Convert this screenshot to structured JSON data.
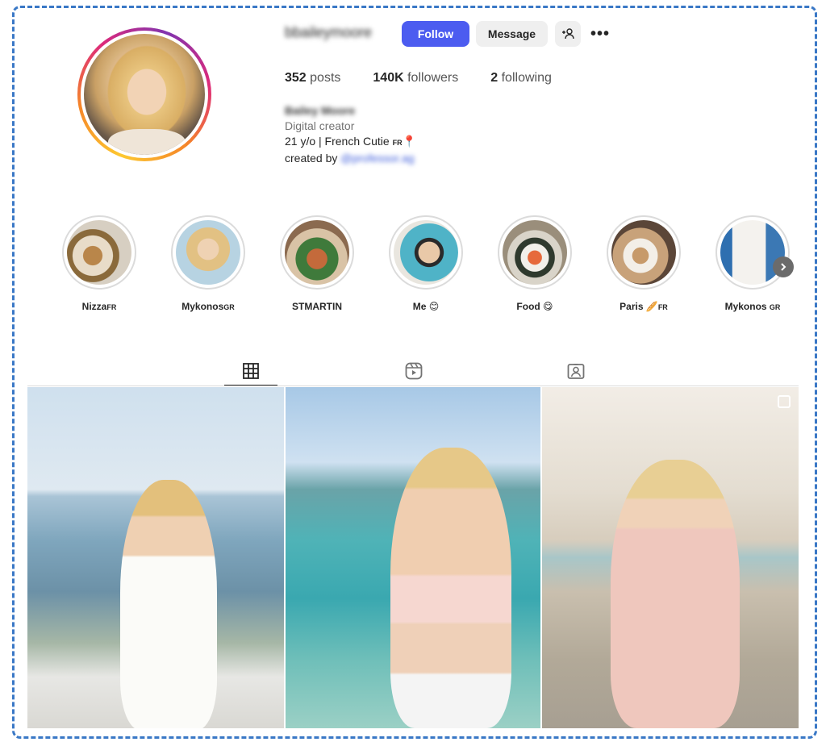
{
  "profile": {
    "username": "bbaileymoore",
    "full_name": "Bailey Moore",
    "category": "Digital creator",
    "bio_line1": "21 y/o | French Cutie ",
    "bio_line1_flag": "FR",
    "bio_line1_emoji": "📍",
    "created_by_prefix": "created by ",
    "created_by_link": "@professor.ag"
  },
  "actions": {
    "follow_label": "Follow",
    "message_label": "Message",
    "more_label": "•••"
  },
  "stats": {
    "posts_value": "352",
    "posts_label": "posts",
    "followers_value": "140K",
    "followers_label": "followers",
    "following_value": "2",
    "following_label": "following"
  },
  "highlights": [
    {
      "label": "Nizza",
      "flag": "FR"
    },
    {
      "label": "Mykonos",
      "flag": "GR"
    },
    {
      "label": "STMARTIN",
      "flag": ""
    },
    {
      "label": "Me 😊",
      "flag": ""
    },
    {
      "label": "Food 😋",
      "flag": ""
    },
    {
      "label": "Paris 🥖",
      "flag": "FR"
    },
    {
      "label": "Mykonos ",
      "flag": "GR"
    }
  ],
  "tabs": [
    {
      "icon": "grid-icon",
      "active": true
    },
    {
      "icon": "reels-icon",
      "active": false
    },
    {
      "icon": "tagged-icon",
      "active": false
    }
  ],
  "colors": {
    "follow_button": "#4c5cf0",
    "frame_border": "#3a78c6"
  }
}
